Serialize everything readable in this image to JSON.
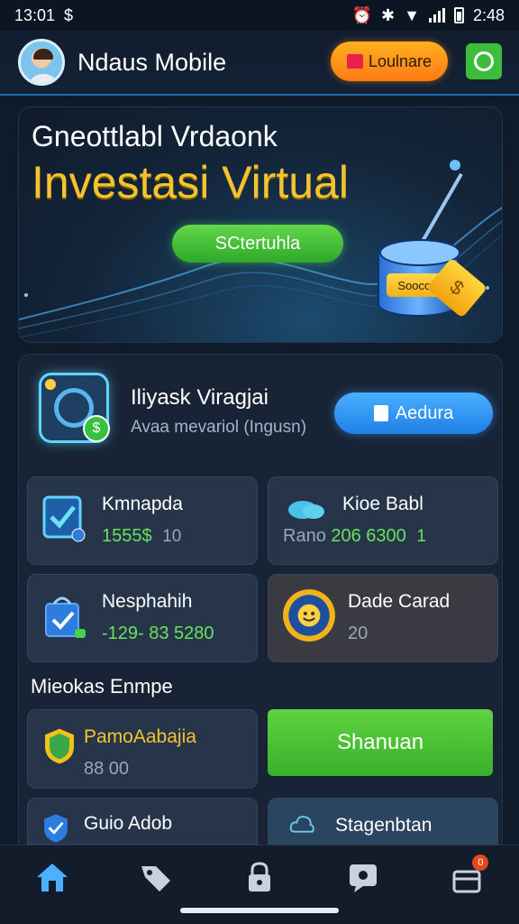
{
  "status_bar": {
    "time": "13:01",
    "extra_icon": "$",
    "clock_right": "2:48",
    "icons": [
      "alarm-icon",
      "vibrate-icon",
      "wifi-icon",
      "signal-icon",
      "battery-icon"
    ]
  },
  "header": {
    "title": "Ndaus Mobile",
    "action_label": "Loulnare",
    "action_icon": "ticket-icon",
    "secondary_icon": "refresh-icon"
  },
  "hero": {
    "subtitle": "Gneottlabl Vrdaonk",
    "title": "Investasi Virtual",
    "button_label": "SCtertuhla",
    "coin_label": "Soocor",
    "ticket_symbol": "$"
  },
  "feature": {
    "title": "Iliyask Viragjai",
    "subtitle": "Avaa mevariol (Ingusn)",
    "button_label": "Aedura",
    "badge_symbol": "$"
  },
  "cards": [
    {
      "label": "Kmnapda",
      "value": "1555$",
      "extra": "10",
      "icon": "checklist-icon"
    },
    {
      "label": "Kioe Babl",
      "prefix": "Rano",
      "value": "206 6300",
      "extra": "1",
      "icon": "cloud-icon"
    },
    {
      "label": "Nesphahih",
      "value": "-129- 83 5280",
      "icon": "shopping-bag-icon"
    },
    {
      "label": "Dade Carad",
      "value": "20",
      "icon": "smiley-coin-icon"
    }
  ],
  "section": {
    "title": "Mieokas Enmpe"
  },
  "list_cards": [
    {
      "label": "PamoAabajia",
      "value": "88 00",
      "icon": "shield-icon"
    },
    {
      "label": "Shanuan",
      "icon": ""
    },
    {
      "label": "Guio Adob",
      "value": "",
      "icon": "check-shield-icon"
    },
    {
      "label": "Stagenbtan",
      "icon": "cloud-outline-icon"
    }
  ],
  "nav": {
    "items": [
      "home-icon",
      "tag-icon",
      "lock-icon",
      "chat-icon",
      "gift-icon"
    ],
    "badge": "0"
  },
  "colors": {
    "accent_green": "#3dbd3b",
    "accent_gold": "#f4c430",
    "accent_blue": "#1f7fe6",
    "accent_orange": "#ff7a12"
  }
}
